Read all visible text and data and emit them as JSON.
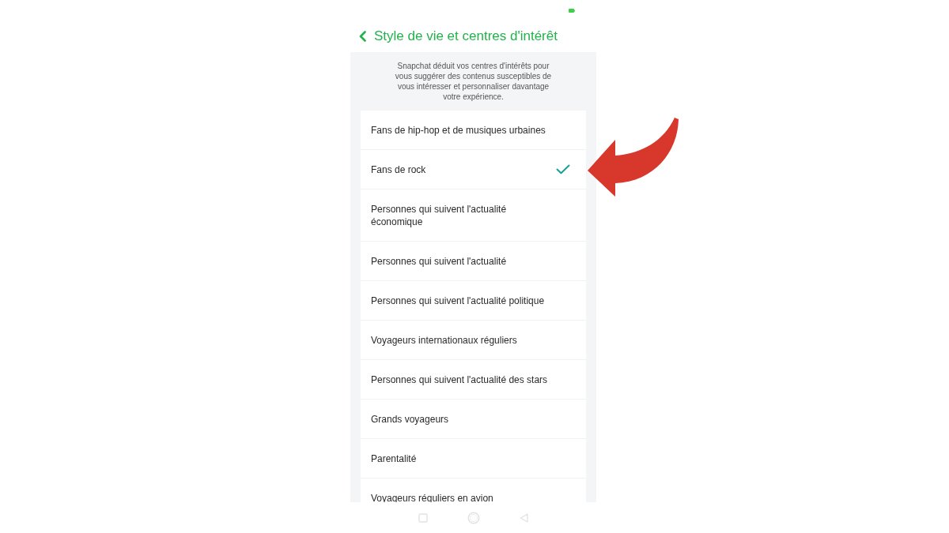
{
  "header": {
    "title": "Style de vie et centres d'intérêt"
  },
  "description": "Snapchat déduit vos centres d'intérêts pour vous suggérer des contenus susceptibles de vous intéresser et personnaliser davantage votre expérience.",
  "interests": [
    {
      "label": "Fans de hip-hop et de musiques urbaines",
      "selected": false
    },
    {
      "label": "Fans de rock",
      "selected": true
    },
    {
      "label": "Personnes qui suivent l'actualité économique",
      "selected": false
    },
    {
      "label": "Personnes qui suivent l'actualité",
      "selected": false
    },
    {
      "label": "Personnes qui suivent l'actualité politique",
      "selected": false
    },
    {
      "label": "Voyageurs internationaux réguliers",
      "selected": false
    },
    {
      "label": "Personnes qui suivent l'actualité des stars",
      "selected": false
    },
    {
      "label": "Grands voyageurs",
      "selected": false
    },
    {
      "label": "Parentalité",
      "selected": false
    },
    {
      "label": "Voyageurs réguliers en avion",
      "selected": false
    }
  ]
}
